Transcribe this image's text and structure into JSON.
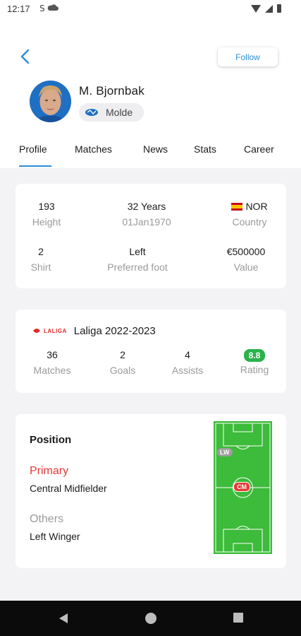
{
  "status_bar": {
    "time": "12:17",
    "left_icons": [
      "sim-icon",
      "cloud-icon"
    ],
    "right_icons": [
      "wifi-icon",
      "signal-icon",
      "battery-icon"
    ]
  },
  "header": {
    "back_icon": "chevron-left-icon",
    "follow_label": "Follow"
  },
  "player": {
    "name": "M. Bjornbak",
    "club": "Molde"
  },
  "tabs": [
    {
      "label": "Profile",
      "active": true
    },
    {
      "label": "Matches",
      "active": false
    },
    {
      "label": "News",
      "active": false
    },
    {
      "label": "Stats",
      "active": false
    },
    {
      "label": "Career",
      "active": false
    }
  ],
  "info": {
    "height": {
      "value": "193",
      "label": "Height"
    },
    "age": {
      "value": "32 Years",
      "label": "01Jan1970"
    },
    "country": {
      "value": "NOR",
      "label": "Country",
      "flag_icon": "spain-flag-icon"
    },
    "shirt": {
      "value": "2",
      "label": "Shirt"
    },
    "foot": {
      "value": "Left",
      "label": "Preferred foot"
    },
    "market_value": {
      "value": "€500000",
      "label": "Value"
    }
  },
  "season": {
    "logo_text": "LALIGA",
    "title": "Laliga 2022-2023",
    "matches": {
      "value": "36",
      "label": "Matches"
    },
    "goals": {
      "value": "2",
      "label": "Goals"
    },
    "assists": {
      "value": "4",
      "label": "Assists"
    },
    "rating": {
      "value": "8.8",
      "label": "Rating"
    }
  },
  "position": {
    "title": "Position",
    "primary_label": "Primary",
    "primary_value": "Central Midfielder",
    "others_label": "Others",
    "others_value": "Left Winger",
    "badge_lw": "LW",
    "badge_cm": "CM"
  },
  "colors": {
    "accent": "#2a8fd6",
    "primary_red": "#e53935",
    "rating_green": "#2bb24c",
    "pitch_green": "#3dbb3a"
  },
  "nav_bar": {
    "icons": [
      "back-triangle-icon",
      "home-circle-icon",
      "recents-square-icon"
    ]
  }
}
